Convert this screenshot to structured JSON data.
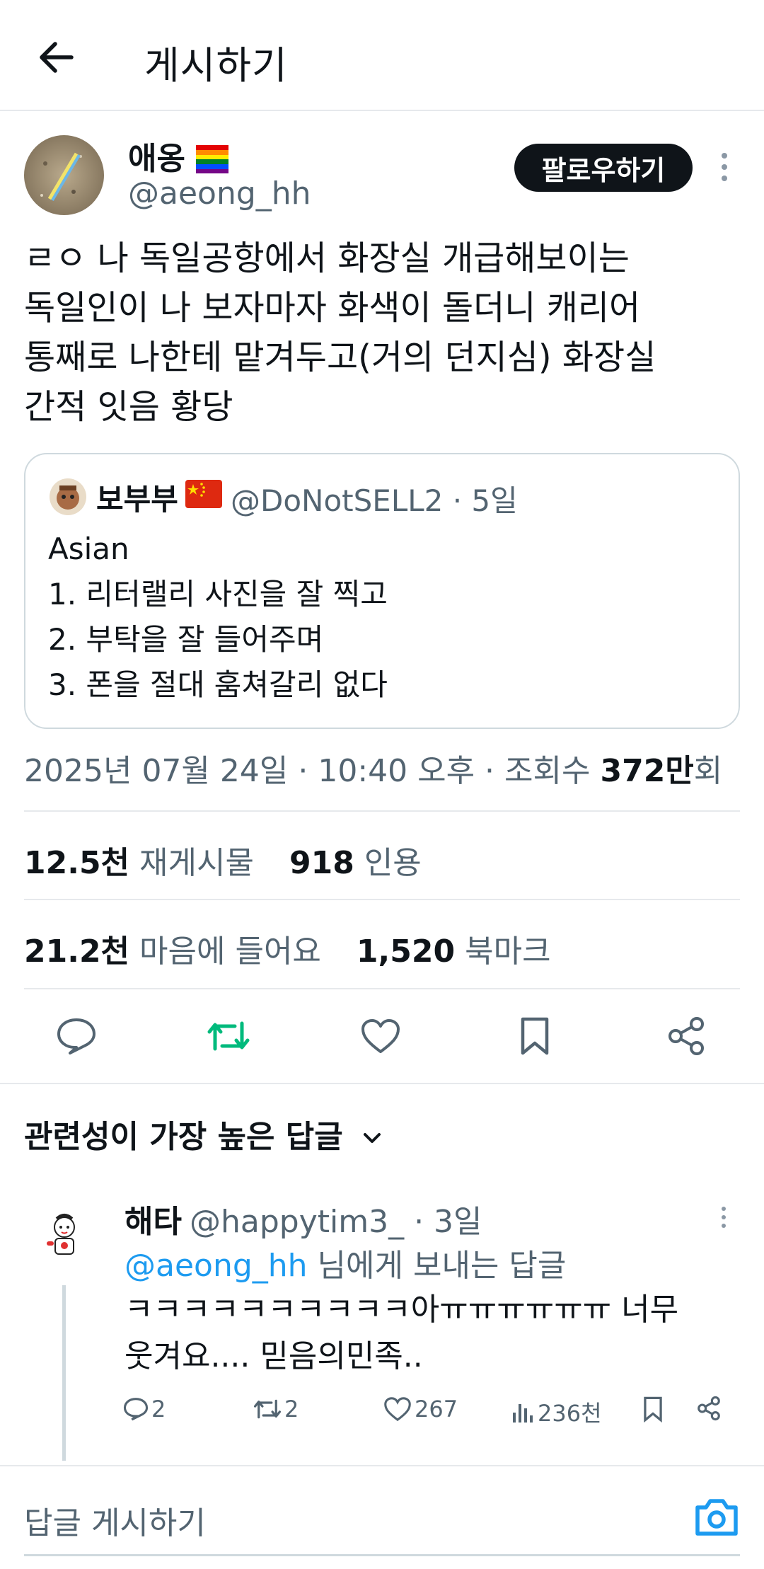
{
  "header": {
    "title": "게시하기",
    "back_icon": "arrow-left-icon"
  },
  "author": {
    "name": "애옹",
    "name_flag": "rainbow-flag",
    "handle": "@aeong_hh",
    "follow_label": "팔로우하기"
  },
  "post": {
    "text": "ㄹㅇ 나 독일공항에서 화장실 개급해보이는\n독일인이 나 보자마자 화색이 돌더니 캐리어\n통째로 나한테 맡겨두고(거의 던지심) 화장실\n간적 잇음 황당"
  },
  "quote": {
    "name": "보부부",
    "flag": "china-flag",
    "handle_meta": "@DoNotSELL2 · 5일",
    "text": "Asian\n1. 리터랠리 사진을 잘 찍고\n2. 부탁을 잘 들어주며\n3. 폰을 절대 훔쳐갈리 없다"
  },
  "meta": {
    "timestamp": "2025년 07월 24일 · 10:40 오후 · 조회수 ",
    "views": "372만",
    "views_suffix": "회"
  },
  "stats": {
    "reposts": "12.5천",
    "reposts_label": "재게시물",
    "quotes": "918",
    "quotes_label": "인용",
    "likes": "21.2천",
    "likes_label": "마음에 들어요",
    "bookmarks": "1,520",
    "bookmarks_label": "북마크"
  },
  "colors": {
    "accent": "#1d9bf0",
    "repost_green": "#00ba7c",
    "text": "#0f1419",
    "muted": "#536471"
  },
  "replies_header": {
    "label": "관련성이 가장 높은 답글"
  },
  "reply": {
    "name": "해타",
    "handle_meta": "@happytim3_ · 3일",
    "reply_to_mention": "@aeong_hh",
    "reply_to_suffix": " 님에게 보내는 답글",
    "text": "ㅋㅋㅋㅋㅋㅋㅋㅋㅋㅋ아ㅠㅠㅠㅠㅠㅠ 너무\n웃겨요.... 믿음의민족..",
    "replies": "2",
    "reposts": "2",
    "likes": "267",
    "views": "236천"
  },
  "compose": {
    "placeholder": "답글 게시하기"
  }
}
